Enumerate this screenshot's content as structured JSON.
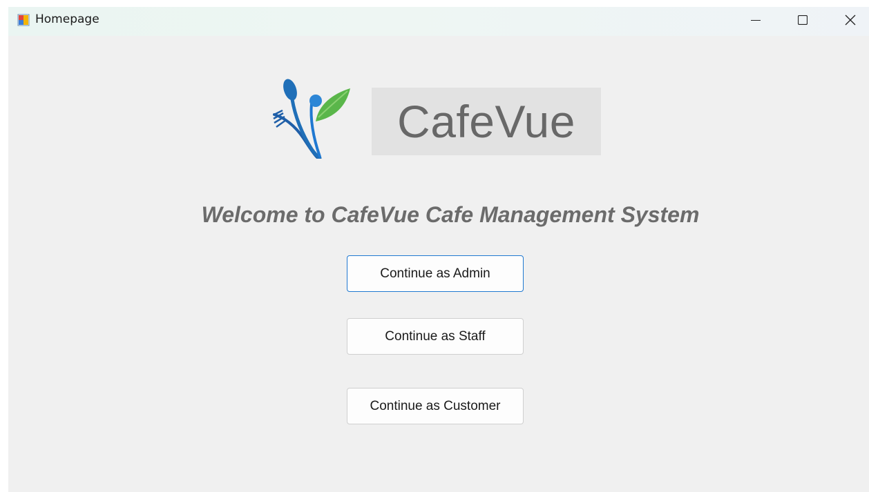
{
  "window": {
    "title": "Homepage",
    "icon": "windows-form-icon",
    "controls": {
      "minimize_icon": "minimize-icon",
      "maximize_icon": "maximize-icon",
      "close_icon": "close-icon"
    }
  },
  "logo": {
    "mark_icon": "cafe-utensils-leaf-icon",
    "text": "CafeVue"
  },
  "welcome": {
    "text": "Welcome to CafeVue Cafe Management System"
  },
  "buttons": {
    "admin_label": "Continue as Admin",
    "staff_label": "Continue as Staff",
    "customer_label": "Continue as Customer",
    "focused": "admin"
  },
  "colors": {
    "background": "#f0f0f0",
    "focus_border": "#1f78d1",
    "logo_blue": "#1f6fb8",
    "logo_green": "#5ab64a",
    "text_gray": "#6b6b6b"
  }
}
